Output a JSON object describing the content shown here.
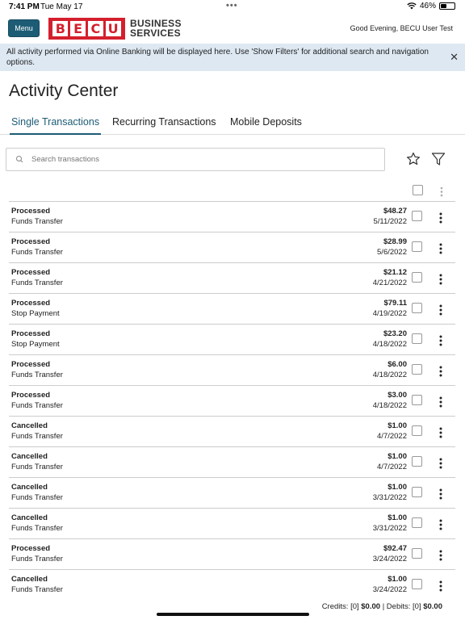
{
  "status_bar": {
    "time": "7:41 PM",
    "date": "Tue May 17",
    "battery": "46%",
    "battery_level": 0.46
  },
  "header": {
    "menu_label": "Menu",
    "logo_letters": [
      "B",
      "E",
      "C",
      "U"
    ],
    "logo_text_line1": "BUSINESS",
    "logo_text_line2": "SERVICES",
    "greeting": "Good Evening, BECU User Test"
  },
  "banner": {
    "message": "All activity performed via Online Banking will be displayed here. Use 'Show Filters' for additional search and navigation options.",
    "close_symbol": "✕"
  },
  "page_title": "Activity Center",
  "tabs": [
    {
      "label": "Single Transactions",
      "active": true
    },
    {
      "label": "Recurring Transactions",
      "active": false
    },
    {
      "label": "Mobile Deposits",
      "active": false
    }
  ],
  "search": {
    "placeholder": "Search transactions",
    "value": ""
  },
  "icons": {
    "search": "search-icon",
    "star": "star-icon",
    "filter": "filter-icon",
    "more": "more-vertical-icon",
    "close": "close-icon"
  },
  "colors": {
    "brand_red": "#d41f2d",
    "accent": "#1d5c75",
    "banner_bg": "#dde8f2"
  },
  "transactions": [
    {
      "status": "Processed",
      "type": "Funds Transfer",
      "amount": "$48.27",
      "date": "5/11/2022"
    },
    {
      "status": "Processed",
      "type": "Funds Transfer",
      "amount": "$28.99",
      "date": "5/6/2022"
    },
    {
      "status": "Processed",
      "type": "Funds Transfer",
      "amount": "$21.12",
      "date": "4/21/2022"
    },
    {
      "status": "Processed",
      "type": "Stop Payment",
      "amount": "$79.11",
      "date": "4/19/2022"
    },
    {
      "status": "Processed",
      "type": "Stop Payment",
      "amount": "$23.20",
      "date": "4/18/2022"
    },
    {
      "status": "Processed",
      "type": "Funds Transfer",
      "amount": "$6.00",
      "date": "4/18/2022"
    },
    {
      "status": "Processed",
      "type": "Funds Transfer",
      "amount": "$3.00",
      "date": "4/18/2022"
    },
    {
      "status": "Cancelled",
      "type": "Funds Transfer",
      "amount": "$1.00",
      "date": "4/7/2022"
    },
    {
      "status": "Cancelled",
      "type": "Funds Transfer",
      "amount": "$1.00",
      "date": "4/7/2022"
    },
    {
      "status": "Cancelled",
      "type": "Funds Transfer",
      "amount": "$1.00",
      "date": "3/31/2022"
    },
    {
      "status": "Cancelled",
      "type": "Funds Transfer",
      "amount": "$1.00",
      "date": "3/31/2022"
    },
    {
      "status": "Processed",
      "type": "Funds Transfer",
      "amount": "$92.47",
      "date": "3/24/2022"
    },
    {
      "status": "Cancelled",
      "type": "Funds Transfer",
      "amount": "$1.00",
      "date": "3/24/2022"
    }
  ],
  "totals": {
    "credits_label": "Credits:",
    "credits_count": "[0]",
    "credits_amount": "$0.00",
    "separator": "|",
    "debits_label": "Debits:",
    "debits_count": "[0]",
    "debits_amount": "$0.00"
  }
}
